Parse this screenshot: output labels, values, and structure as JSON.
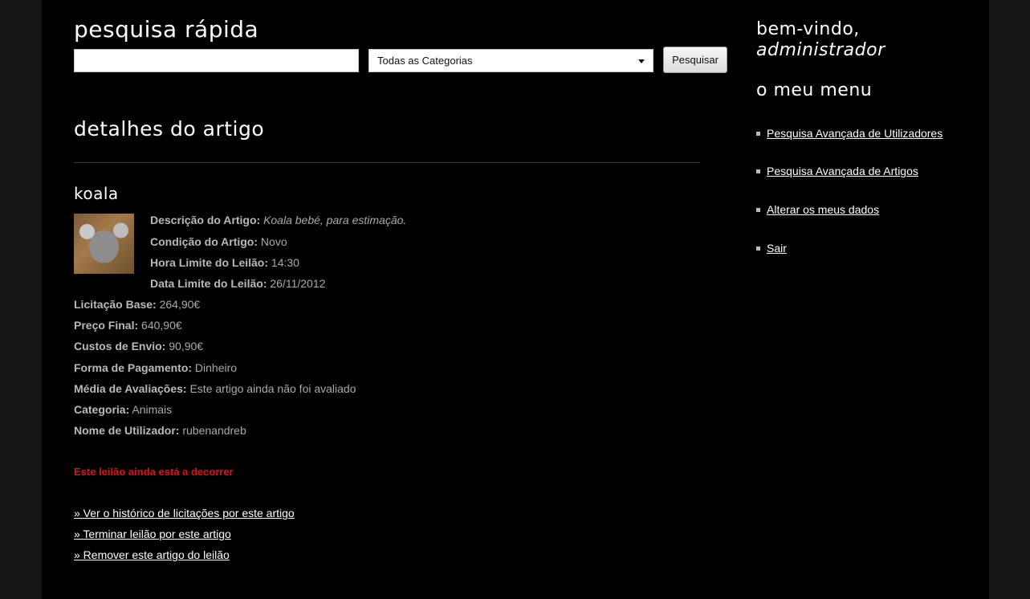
{
  "quick_search": {
    "title": "pesquisa rápida",
    "input_value": "",
    "category_selected": "Todas as Categorias",
    "search_button": "Pesquisar"
  },
  "details": {
    "title": "detalhes do artigo",
    "item_name": "koala",
    "fields": [
      {
        "label": "Descrição do Artigo:",
        "value": "Koala bebé, para estimação."
      },
      {
        "label": "Condição do Artigo:",
        "value": "Novo"
      },
      {
        "label": "Hora Limite do Leilão:",
        "value": "14:30"
      },
      {
        "label": "Data Limite do Leilão:",
        "value": "26/11/2012"
      },
      {
        "label": "Licitação Base:",
        "value": "264,90€"
      },
      {
        "label": "Preço Final:",
        "value": "640,90€"
      },
      {
        "label": "Custos de Envio:",
        "value": "90,90€"
      },
      {
        "label": "Forma de Pagamento:",
        "value": "Dinheiro"
      },
      {
        "label": "Média de Avaliações:",
        "value": "Este artigo ainda não foi avaliado"
      },
      {
        "label": "Categoria:",
        "value": "Animais"
      },
      {
        "label": "Nome de Utilizador:",
        "value": "rubenandreb"
      }
    ],
    "status": "Este leilão ainda está a decorrer",
    "actions": [
      "» Ver o histórico de licitações por este artigo",
      "» Terminar leilão por este artigo",
      "» Remover este artigo do leilão"
    ]
  },
  "sidebar": {
    "welcome": "bem-vindo,",
    "user": "administrador",
    "menu_title": "o meu menu",
    "menu_items": [
      "Pesquisa Avançada de Utilizadores",
      "Pesquisa Avançada de Artigos",
      "Alterar os meus dados",
      "Sair"
    ]
  },
  "colors": {
    "background": "#000000",
    "status_red": "#e0101a",
    "link": "#ffffff"
  }
}
